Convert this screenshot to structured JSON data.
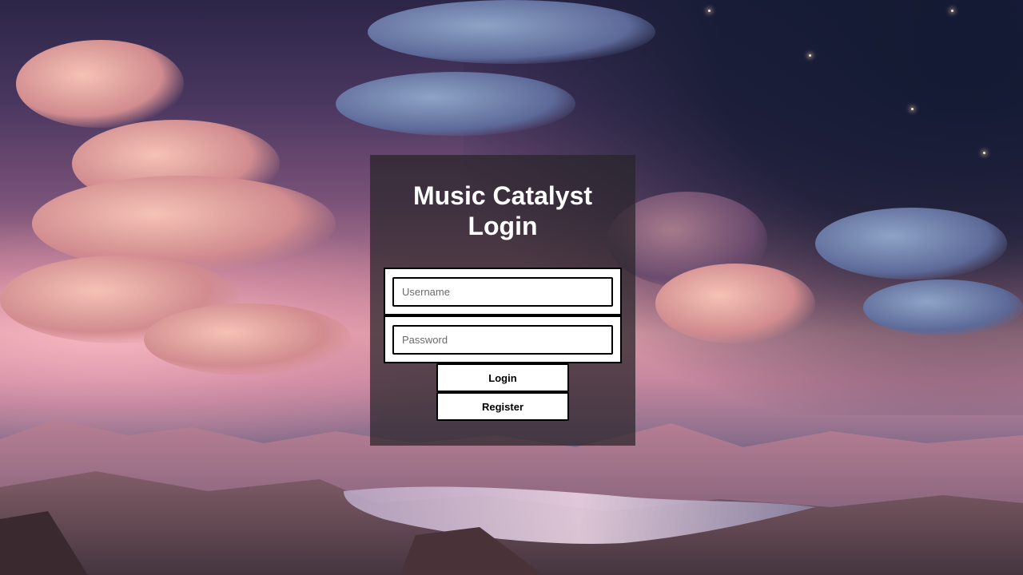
{
  "login": {
    "title_line1": "Music Catalyst",
    "title_line2": "Login",
    "username_placeholder": "Username",
    "username_value": "",
    "password_placeholder": "Password",
    "password_value": "",
    "login_button": "Login",
    "register_button": "Register"
  },
  "theme": {
    "panel_background": "#28242ab8",
    "text_color": "#ffffff",
    "border_color": "#000000"
  }
}
